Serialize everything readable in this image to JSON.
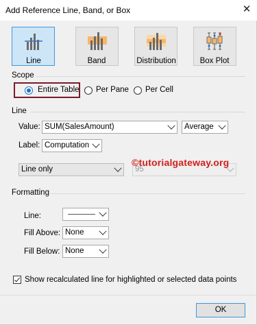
{
  "dialog": {
    "title": "Add Reference Line, Band, or Box",
    "close_glyph": "✕"
  },
  "type_buttons": [
    {
      "label": "Line",
      "icon": "line-chart-icon",
      "selected": true
    },
    {
      "label": "Band",
      "icon": "band-chart-icon",
      "selected": false
    },
    {
      "label": "Distribution",
      "icon": "distribution-chart-icon",
      "selected": false
    },
    {
      "label": "Box Plot",
      "icon": "box-plot-icon",
      "selected": false
    }
  ],
  "scope": {
    "heading": "Scope",
    "options": [
      {
        "label": "Entire Table",
        "selected": true
      },
      {
        "label": "Per Pane",
        "selected": false
      },
      {
        "label": "Per Cell",
        "selected": false
      }
    ]
  },
  "line": {
    "heading": "Line",
    "value_label": "Value:",
    "value": "SUM(SalesAmount)",
    "aggregation": "Average",
    "label_label": "Label:",
    "label_value": "Computation",
    "line_select": "Line only",
    "confidence": "95"
  },
  "watermark": "©tutorialgateway.org",
  "formatting": {
    "heading": "Formatting",
    "line_label": "Line:",
    "fill_above_label": "Fill Above:",
    "fill_above": "None",
    "fill_below_label": "Fill Below:",
    "fill_below": "None"
  },
  "recalc_checkbox": {
    "label": "Show recalculated line for highlighted or selected data points",
    "checked": true
  },
  "ok_label": "OK",
  "colors": {
    "accent": "#3f97d9",
    "selected_bg": "#cde6f7",
    "highlight_box": "#7b1a2a",
    "watermark": "#d1221f",
    "bar_orange": "#f7b76b"
  }
}
